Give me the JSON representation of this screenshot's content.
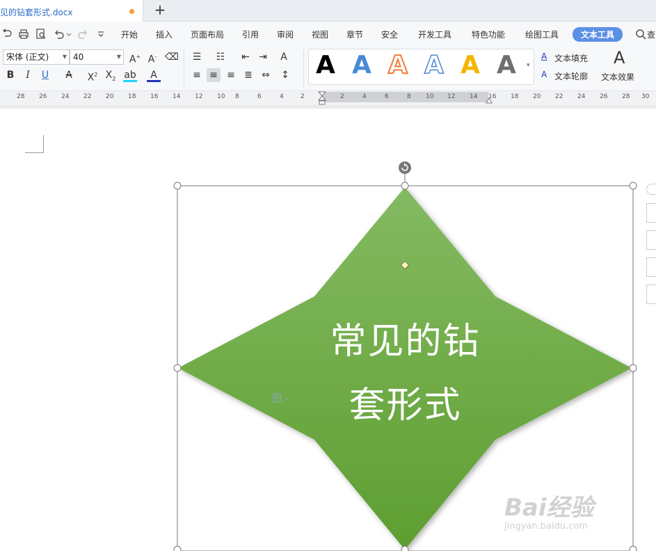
{
  "tab": {
    "title": "见的钻套形式.docx",
    "new_tab_label": "+"
  },
  "menu": {
    "items": [
      "开始",
      "插入",
      "页面布局",
      "引用",
      "审阅",
      "视图",
      "章节",
      "安全",
      "开发工具",
      "特色功能",
      "绘图工具"
    ],
    "active": "文本工具",
    "search_partial": "查"
  },
  "ribbon": {
    "font_name": "宋体 (正文)",
    "font_size": "40",
    "text_fill_label": "文本填充",
    "text_outline_label": "文本轮廓",
    "text_effect_label": "文本效果",
    "style_letter": "A",
    "style_colors": [
      "#000000",
      "#4a89d6",
      "#f07b38",
      "#4a89d6",
      "#f5b400",
      "#6f6f6f"
    ]
  },
  "ruler": {
    "numbers": [
      "28",
      "26",
      "24",
      "22",
      "20",
      "18",
      "16",
      "14",
      "12",
      "10",
      "8",
      "6",
      "4",
      "2",
      "2",
      "4",
      "6",
      "8",
      "10",
      "12",
      "14",
      "16",
      "18",
      "20",
      "22",
      "24",
      "26",
      "28",
      "30"
    ]
  },
  "shape": {
    "line1": "常见的钻",
    "line2": "套形式",
    "fill_top": "#82b95f",
    "fill_bottom": "#5e9e32"
  },
  "watermark": {
    "logo": "Bai经验",
    "sub": "jingyan.baidu.com"
  }
}
